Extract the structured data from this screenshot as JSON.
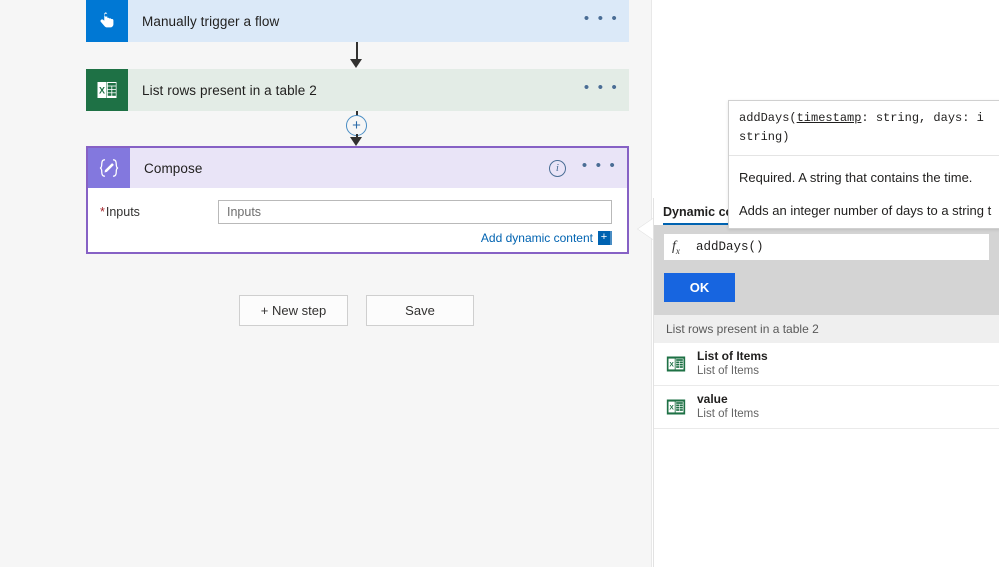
{
  "flow": {
    "steps": [
      {
        "title": "Manually trigger a flow",
        "icon": "tap-hand-icon",
        "menu": "• • •"
      },
      {
        "title": "List rows present in a table 2",
        "icon": "excel-icon",
        "menu": "• • •"
      }
    ],
    "compose": {
      "title": "Compose",
      "icon": "compose-braces-icon",
      "info": "i",
      "menu": "• • •",
      "field_label": "Inputs",
      "required_marker": "*",
      "field_placeholder": "Inputs",
      "field_value": "",
      "add_dynamic_content": "Add dynamic content",
      "add_dynamic_plus": "+"
    },
    "insert_node": "+",
    "buttons": {
      "new_step": "+ New step",
      "save": "Save"
    }
  },
  "flyout": {
    "tab_label": "Dynamic co",
    "expression": "addDays()",
    "fx_symbol": "f",
    "fx_sub": "x",
    "ok_label": "OK",
    "group_header": "List rows present in a table 2",
    "items": [
      {
        "name": "List of Items",
        "desc": "List of Items",
        "icon": "excel-icon"
      },
      {
        "name": "value",
        "desc": "List of Items",
        "icon": "excel-icon"
      }
    ]
  },
  "tooltip": {
    "signature_line1_pre": "addDays(",
    "signature_param": "timestamp",
    "signature_line1_post": ":   string,   days:   i",
    "signature_line2": "string)",
    "description": "Required. A string that contains the time.",
    "summary": "Adds an integer number of days to a string t"
  },
  "colors": {
    "trigger_blue": "#0078d4",
    "trigger_bg": "#dbe9f8",
    "excel_green": "#1e7145",
    "excel_bg": "#e3ece6",
    "compose_purple": "#8661c5",
    "compose_bg": "#e9e4f7",
    "link_blue": "#0063b1",
    "ok_blue": "#1765e0",
    "required_red": "#a4262c"
  }
}
